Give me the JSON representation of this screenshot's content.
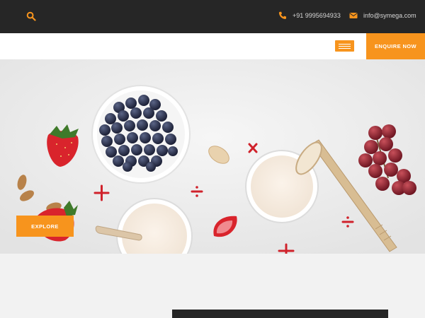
{
  "topbar": {
    "search_icon": "search-icon",
    "phone_icon": "phone-icon",
    "phone": "+91 9995694933",
    "email_icon": "envelope-icon",
    "email": "info@symega.com"
  },
  "navbar": {
    "menu_icon": "hamburger-menu-icon",
    "enquire_label": "ENQUIRE NOW"
  },
  "hero": {
    "explore_label": "EXPLORE",
    "image_subject": [
      "blueberries",
      "strawberry",
      "almonds",
      "milk glasses",
      "grapes",
      "wooden spoon"
    ]
  },
  "colors": {
    "accent": "#f7941d",
    "topbar": "#262626",
    "math_symbols": "#d0222b"
  }
}
